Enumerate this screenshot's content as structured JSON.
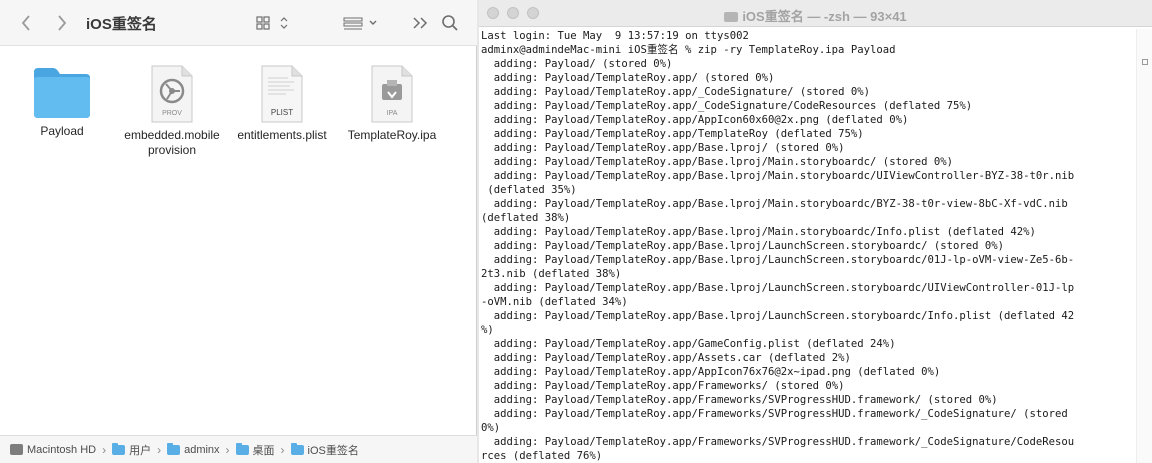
{
  "finder": {
    "title": "iOS重签名",
    "files": [
      {
        "name": "Payload",
        "kind": "folder"
      },
      {
        "name": "embedded.mobileprovision",
        "line1": "embedded.mobile",
        "line2": "provision",
        "badge": "PROV"
      },
      {
        "name": "entitlements.plist",
        "badge": "PLIST"
      },
      {
        "name": "TemplateRoy.ipa",
        "badge": "IPA"
      }
    ],
    "pathbar": [
      "Macintosh HD",
      "用户",
      "adminx",
      "桌面",
      "iOS重签名"
    ]
  },
  "terminal": {
    "title": "iOS重签名 — -zsh — 93×41",
    "lines": [
      "Last login: Tue May  9 13:57:19 on ttys002",
      "adminx@admindeMac-mini iOS重签名 % zip -ry TemplateRoy.ipa Payload",
      "  adding: Payload/ (stored 0%)",
      "  adding: Payload/TemplateRoy.app/ (stored 0%)",
      "  adding: Payload/TemplateRoy.app/_CodeSignature/ (stored 0%)",
      "  adding: Payload/TemplateRoy.app/_CodeSignature/CodeResources (deflated 75%)",
      "  adding: Payload/TemplateRoy.app/AppIcon60x60@2x.png (deflated 0%)",
      "  adding: Payload/TemplateRoy.app/TemplateRoy (deflated 75%)",
      "  adding: Payload/TemplateRoy.app/Base.lproj/ (stored 0%)",
      "  adding: Payload/TemplateRoy.app/Base.lproj/Main.storyboardc/ (stored 0%)",
      "  adding: Payload/TemplateRoy.app/Base.lproj/Main.storyboardc/UIViewController-BYZ-38-t0r.nib",
      " (deflated 35%)",
      "  adding: Payload/TemplateRoy.app/Base.lproj/Main.storyboardc/BYZ-38-t0r-view-8bC-Xf-vdC.nib",
      "(deflated 38%)",
      "  adding: Payload/TemplateRoy.app/Base.lproj/Main.storyboardc/Info.plist (deflated 42%)",
      "  adding: Payload/TemplateRoy.app/Base.lproj/LaunchScreen.storyboardc/ (stored 0%)",
      "  adding: Payload/TemplateRoy.app/Base.lproj/LaunchScreen.storyboardc/01J-lp-oVM-view-Ze5-6b-",
      "2t3.nib (deflated 38%)",
      "  adding: Payload/TemplateRoy.app/Base.lproj/LaunchScreen.storyboardc/UIViewController-01J-lp",
      "-oVM.nib (deflated 34%)",
      "  adding: Payload/TemplateRoy.app/Base.lproj/LaunchScreen.storyboardc/Info.plist (deflated 42",
      "%)",
      "  adding: Payload/TemplateRoy.app/GameConfig.plist (deflated 24%)",
      "  adding: Payload/TemplateRoy.app/Assets.car (deflated 2%)",
      "  adding: Payload/TemplateRoy.app/AppIcon76x76@2x~ipad.png (deflated 0%)",
      "  adding: Payload/TemplateRoy.app/Frameworks/ (stored 0%)",
      "  adding: Payload/TemplateRoy.app/Frameworks/SVProgressHUD.framework/ (stored 0%)",
      "  adding: Payload/TemplateRoy.app/Frameworks/SVProgressHUD.framework/_CodeSignature/ (stored",
      "0%)",
      "  adding: Payload/TemplateRoy.app/Frameworks/SVProgressHUD.framework/_CodeSignature/CodeResou",
      "rces (deflated 76%)"
    ]
  },
  "colors": {
    "folder": "#5ab4ea",
    "terminal_bg": "#ffffff",
    "finder_toolbar": "#f6f6f6"
  }
}
